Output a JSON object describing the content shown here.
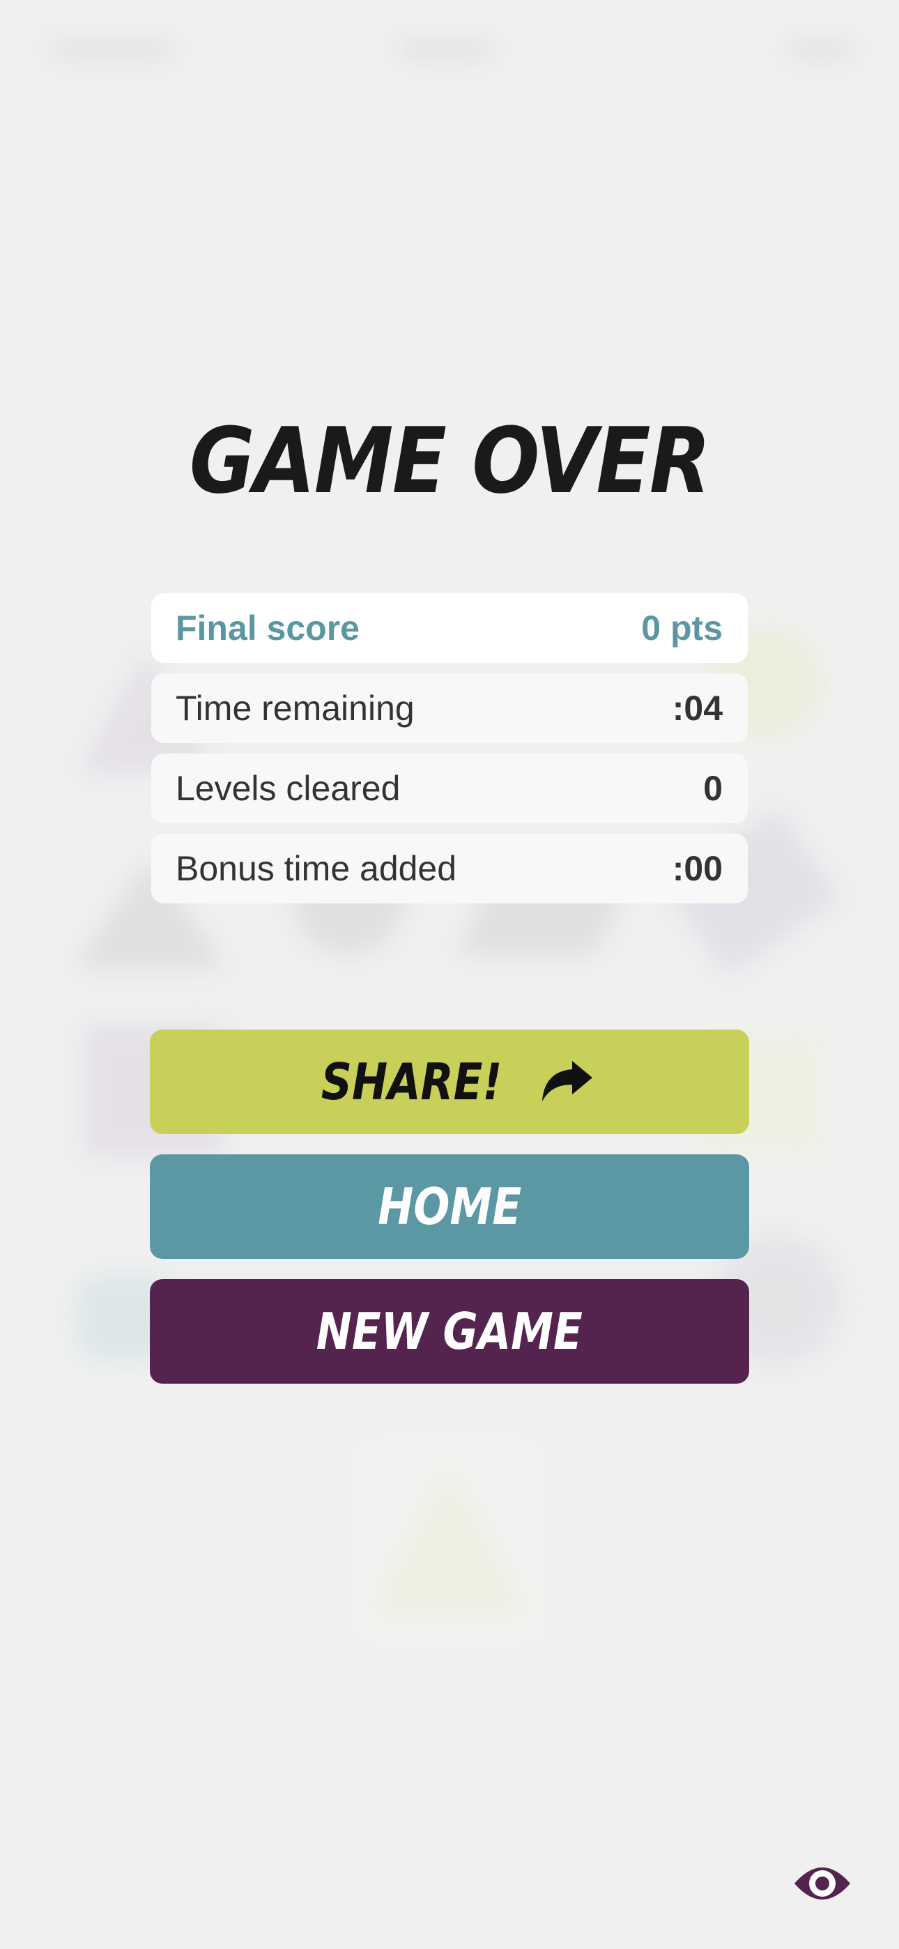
{
  "title": "GAME OVER",
  "stats": [
    {
      "label": "Final score",
      "value": "0 pts"
    },
    {
      "label": "Time remaining",
      "value": ":04"
    },
    {
      "label": "Levels cleared",
      "value": "0"
    },
    {
      "label": "Bonus time added",
      "value": ":00"
    }
  ],
  "buttons": {
    "share": "SHARE!",
    "home": "HOME",
    "new_game": "NEW GAME"
  },
  "icons": {
    "share": "share-arrow-icon",
    "eye": "eye-icon"
  },
  "colors": {
    "background": "#f0f0f0",
    "score_accent": "#5b97a2",
    "share_button": "#c8d05a",
    "home_button": "#5b98a3",
    "new_game_button": "#55244e",
    "eye_icon": "#55244e"
  }
}
